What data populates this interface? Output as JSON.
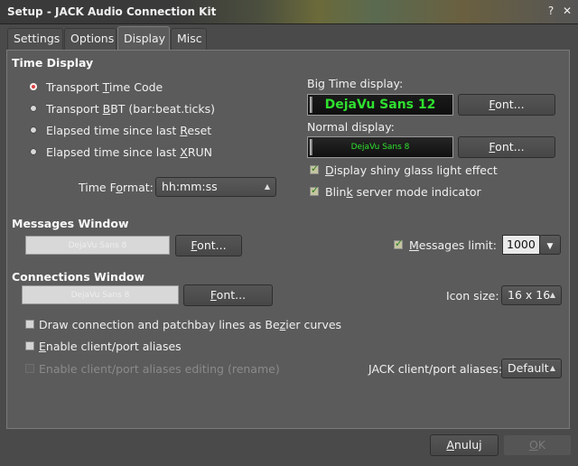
{
  "window": {
    "title": "Setup - JACK Audio Connection Kit",
    "controls": {
      "help": "?",
      "close": "✕"
    }
  },
  "tabs": [
    {
      "label": "Settings"
    },
    {
      "label": "Options"
    },
    {
      "label": "Display",
      "active": true
    },
    {
      "label": "Misc"
    }
  ],
  "time_display": {
    "heading": "Time Display",
    "options": [
      {
        "pre": "Transport ",
        "mn": "T",
        "post": "ime Code",
        "selected": true
      },
      {
        "pre": "Transport ",
        "mn": "B",
        "post": "BT (bar:beat.ticks)",
        "selected": false
      },
      {
        "pre": "Elapsed time since last ",
        "mn": "R",
        "post": "eset",
        "selected": false
      },
      {
        "pre": "Elapsed time since last ",
        "mn": "X",
        "post": "RUN",
        "selected": false
      }
    ],
    "time_format_label": "Time Format:",
    "time_format_mn": "o",
    "time_format_value": "hh:mm:ss",
    "big_time_label": "Big Time display:",
    "big_time_font_preview": "DejaVu Sans 12",
    "normal_label": "Normal display:",
    "normal_font_preview": "DejaVu Sans 8",
    "font_button": "Font...",
    "shiny_glass": {
      "pre": "",
      "mn": "D",
      "post": "isplay shiny glass light effect",
      "checked": true
    },
    "blink": {
      "pre": "Blin",
      "mn": "k",
      "post": " server mode indicator",
      "checked": true
    }
  },
  "messages_window": {
    "heading": "Messages Window",
    "font_preview": "DejaVu Sans 8",
    "font_button": "Font...",
    "limit_label_mn": "M",
    "limit_label_rest": "essages limit:",
    "limit_checked": true,
    "limit_value": "1000"
  },
  "connections_window": {
    "heading": "Connections Window",
    "font_preview": "DejaVu Sans 8",
    "font_button": "Font...",
    "icon_size_label": "Icon size:",
    "icon_size_value": "16 x 16",
    "bezier": {
      "pre": "Draw connection and patchbay lines as Be",
      "mn": "z",
      "post": "ier curves",
      "checked": false
    },
    "aliases": {
      "pre": "",
      "mn": "E",
      "post": "nable client/port aliases",
      "checked": false
    },
    "aliases_editing": {
      "label": "Enable client/port aliases editing (rename)",
      "checked": false,
      "disabled": true
    },
    "jack_aliases_label": "JACK client/port aliases:",
    "jack_aliases_value": "Default"
  },
  "dialog_buttons": {
    "cancel_pre": "",
    "cancel_mn": "A",
    "cancel_post": "nuluj",
    "ok_pre": "",
    "ok_mn": "O",
    "ok_post": "K"
  },
  "colors": {
    "window_bg": "#4a4a4a",
    "panel_bg": "#5b5b5b",
    "lcd_green": "#2fe02f",
    "radio_selected": "#e04040"
  }
}
